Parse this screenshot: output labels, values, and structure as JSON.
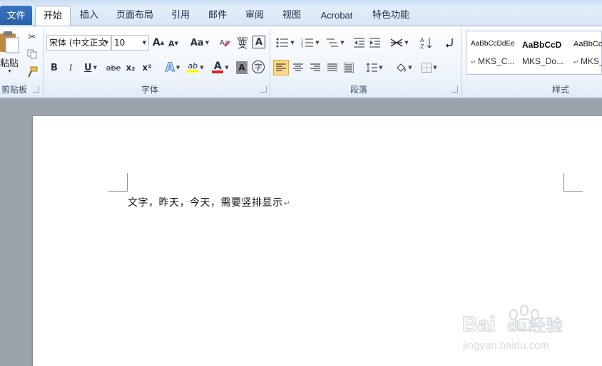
{
  "tabs": {
    "file": "文件",
    "items": [
      "开始",
      "插入",
      "页面布局",
      "引用",
      "邮件",
      "审阅",
      "视图",
      "Acrobat",
      "特色功能"
    ]
  },
  "clipboard": {
    "paste_label": "粘贴",
    "group_label": "剪贴板"
  },
  "font": {
    "name": "宋体 (中文正文",
    "size": "10",
    "grow_label": "A",
    "shrink_label": "A",
    "case_label": "Aa",
    "bold": "B",
    "italic": "I",
    "underline": "U",
    "strike": "abe",
    "subscript": "x₂",
    "superscript": "x²",
    "clear_label": "A",
    "effects_label": "A",
    "highlight_label": "ab",
    "color_label": "A",
    "shading_label": "A",
    "enclose_label": "字",
    "phonetic_label": "wén",
    "phonetic_char": "变",
    "border_label": "A",
    "group_label": "字体",
    "highlight_color": "#ffff00",
    "font_color": "#e02020"
  },
  "paragraph": {
    "group_label": "段落"
  },
  "styles": {
    "group_label": "样式",
    "items": [
      {
        "sample": "AaBbCcDdEe",
        "name": "MKS_C..."
      },
      {
        "sample": "AaBbCcD",
        "name": "MKS_Do..."
      },
      {
        "sample": "AaBbCc",
        "name": "MKS_"
      }
    ]
  },
  "document": {
    "text": "文字，昨天，今天，需要竖排显示",
    "paragraph_mark": "↵"
  },
  "watermark": {
    "brand": "Bai",
    "brand2": "du",
    "cn": "经验",
    "url": "jingyan.baidu.com"
  }
}
